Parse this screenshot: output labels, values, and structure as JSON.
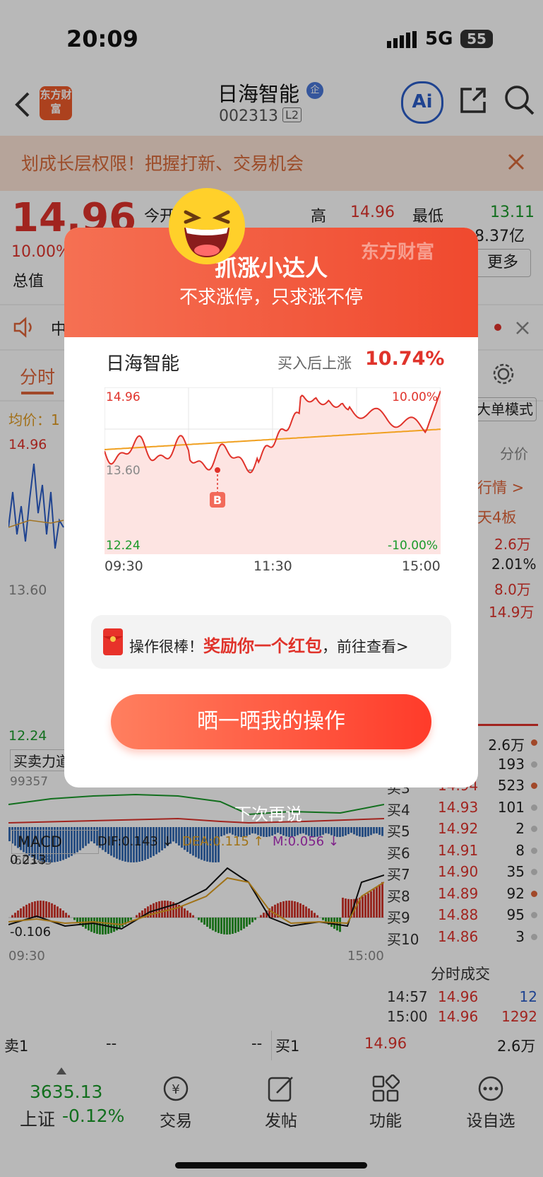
{
  "status_bar": {
    "time": "20:09",
    "network": "5G",
    "battery": "55"
  },
  "header": {
    "stock_name": "日海智能",
    "stock_code": "002313",
    "level_badge": "L2",
    "qi_badge": "企",
    "logo_text": "东方财富",
    "ai_label": "Ai"
  },
  "banner": {
    "text": "划成长层权限！把握打新、交易机会"
  },
  "quote": {
    "price": "14.96",
    "change_pct": "10.00%",
    "open_label": "今开",
    "open_value": "14",
    "high_label": "高",
    "high_value": "14.96",
    "low_label": "最低",
    "low_value": "13.11",
    "market_value_label": "总值",
    "market_value": "8.37亿",
    "more_label": "更多"
  },
  "news": {
    "text": "中"
  },
  "tabs": {
    "tab1": "分时"
  },
  "main_chart": {
    "avg_label": "均价：1",
    "price_top": "14.96",
    "price_ref": "13.60",
    "price_bottom": "12.24",
    "mode_label": "大单模式",
    "fenjia": "分价",
    "quote_link": "行情 >",
    "days_board": "天4板",
    "side_values": [
      "2.6万",
      "2.01%",
      "8.0万",
      "14.9万"
    ],
    "bsf_label": "买卖力道",
    "bsf_max": "99357",
    "bsf_min": "-60345"
  },
  "order_book": {
    "rows": [
      {
        "label": "",
        "price": "",
        "vol": "2.6万"
      },
      {
        "label": "",
        "price": "",
        "vol": "193"
      },
      {
        "label": "买3",
        "price": "14.94",
        "vol": "523"
      },
      {
        "label": "买4",
        "price": "14.93",
        "vol": "101"
      },
      {
        "label": "买5",
        "price": "14.92",
        "vol": "2"
      },
      {
        "label": "买6",
        "price": "14.91",
        "vol": "8"
      },
      {
        "label": "买7",
        "price": "14.90",
        "vol": "35"
      },
      {
        "label": "买8",
        "price": "14.89",
        "vol": "92"
      },
      {
        "label": "买9",
        "price": "14.88",
        "vol": "95"
      },
      {
        "label": "买10",
        "price": "14.86",
        "vol": "3"
      }
    ],
    "trade_title": "分时成交",
    "trades": [
      {
        "time": "14:57",
        "price": "14.96",
        "vol": "12"
      },
      {
        "time": "15:00",
        "price": "14.96",
        "vol": "1292"
      }
    ]
  },
  "macd": {
    "label": "MACD",
    "dif": "DIF:0.143 ↓",
    "dea": "DEA:0.115 ↑",
    "m": "M:0.056 ↓",
    "top": "0.213",
    "bottom": "-0.106",
    "start_time": "09:30",
    "end_time": "15:00"
  },
  "sell_buy": {
    "sell_label": "卖1",
    "sell_price": "--",
    "sell_vol": "--",
    "buy_label": "买1",
    "buy_price": "14.96",
    "buy_vol": "2.6万"
  },
  "bottom_nav": {
    "index_value": "3635.13",
    "index_name": "上证",
    "index_change": "-0.12%",
    "items": [
      {
        "label": "交易"
      },
      {
        "label": "发帖"
      },
      {
        "label": "功能"
      },
      {
        "label": "设自选"
      }
    ]
  },
  "popup": {
    "brand": "东方财富",
    "title": "抓涨小达人",
    "subtitle": "不求涨停，只求涨不停",
    "stock_name": "日海智能",
    "gain_label": "买入后上涨",
    "gain_value": "10.74%",
    "y_top": "14.96",
    "y_mid": "13.60",
    "y_bottom": "12.24",
    "pct_top": "10.00%",
    "pct_bottom": "-10.00%",
    "x_labels": [
      "09:30",
      "11:30",
      "15:00"
    ],
    "buy_marker": "B",
    "reward_prefix": "操作很棒！",
    "reward_highlight": "奖励你一个红包",
    "reward_suffix": "，前往查看>",
    "share_button": "晒一晒我的操作",
    "dismiss": "下次再说"
  },
  "colors": {
    "accent": "#e0332b",
    "green": "#1a9a2a",
    "avg_line": "#f0a020"
  }
}
